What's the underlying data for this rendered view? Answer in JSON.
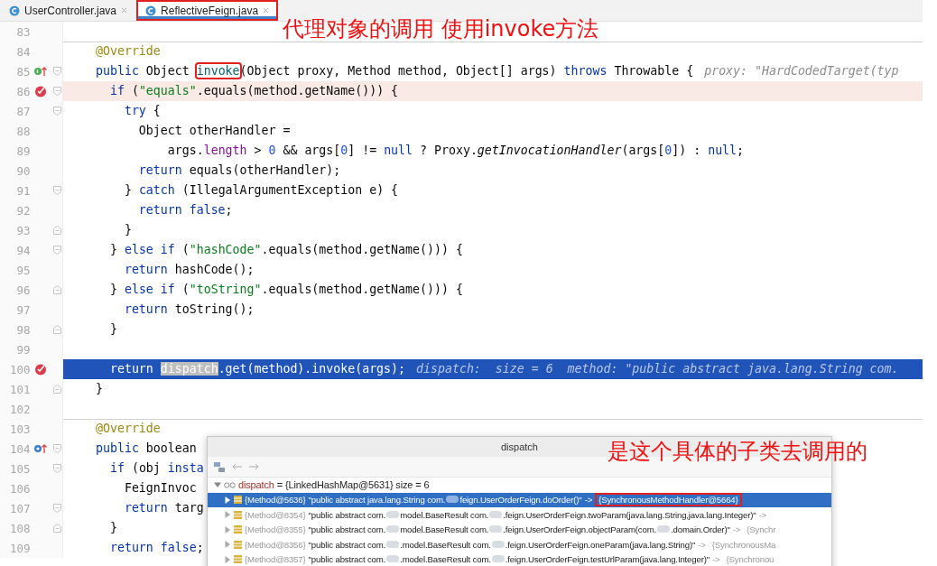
{
  "tabs": [
    {
      "label": "UserController.java",
      "selected": false,
      "boxed": false
    },
    {
      "label": "ReflectiveFeign.java",
      "selected": true,
      "boxed": true
    }
  ],
  "editor": {
    "lines": [
      {
        "number": "83"
      },
      {
        "number": "84",
        "separator": true,
        "tokens": [
          {
            "t": "@Override",
            "kind": "annotation"
          }
        ]
      },
      {
        "number": "85",
        "implements": true,
        "fold_start": true,
        "tokens": [
          {
            "t": "public",
            "kind": "keyword"
          },
          {
            "t": " Object ",
            "kind": "plain"
          },
          {
            "t": "invoke",
            "kind": "declaration",
            "boxed": true
          },
          {
            "t": "(Object proxy, Method method, Object[] args) ",
            "kind": "plain"
          },
          {
            "t": "throws",
            "kind": "keyword"
          },
          {
            "t": " Throwable {",
            "kind": "plain"
          },
          {
            "t": "proxy: \"HardCodedTarget(typ",
            "kind": "hint"
          }
        ]
      },
      {
        "number": "86",
        "breakpoint": true,
        "fold_start": true,
        "tokens": [
          {
            "t": "  if",
            "kind": "keyword"
          },
          {
            "t": " (",
            "kind": "plain"
          },
          {
            "t": "\"equals\"",
            "kind": "string"
          },
          {
            "t": ".equals(method.getName())) {",
            "kind": "plain"
          }
        ]
      },
      {
        "number": "87",
        "fold_start": true,
        "tokens": [
          {
            "t": "    try",
            "kind": "keyword"
          },
          {
            "t": " {",
            "kind": "plain"
          }
        ]
      },
      {
        "number": "88",
        "tokens": [
          {
            "t": "      Object otherHandler =",
            "kind": "plain"
          }
        ]
      },
      {
        "number": "89",
        "tokens": [
          {
            "t": "          args.",
            "kind": "plain"
          },
          {
            "t": "length",
            "kind": "field"
          },
          {
            "t": " > ",
            "kind": "plain"
          },
          {
            "t": "0",
            "kind": "number"
          },
          {
            "t": " && args[",
            "kind": "plain"
          },
          {
            "t": "0",
            "kind": "number"
          },
          {
            "t": "] != ",
            "kind": "plain"
          },
          {
            "t": "null",
            "kind": "keyword"
          },
          {
            "t": " ? Proxy.",
            "kind": "plain"
          },
          {
            "t": "getInvocationHandler",
            "kind": "static"
          },
          {
            "t": "(args[",
            "kind": "plain"
          },
          {
            "t": "0",
            "kind": "number"
          },
          {
            "t": "]) : ",
            "kind": "plain"
          },
          {
            "t": "null",
            "kind": "keyword"
          },
          {
            "t": ";",
            "kind": "plain"
          }
        ]
      },
      {
        "number": "90",
        "tokens": [
          {
            "t": "      return",
            "kind": "keyword"
          },
          {
            "t": " equals(otherHandler);",
            "kind": "plain"
          }
        ]
      },
      {
        "number": "91",
        "fold_start": true,
        "tokens": [
          {
            "t": "    } ",
            "kind": "plain"
          },
          {
            "t": "catch",
            "kind": "keyword"
          },
          {
            "t": " (IllegalArgumentException e) {",
            "kind": "plain"
          }
        ]
      },
      {
        "number": "92",
        "tokens": [
          {
            "t": "      return false",
            "kind": "keyword"
          },
          {
            "t": ";",
            "kind": "plain"
          }
        ]
      },
      {
        "number": "93",
        "fold_end": true,
        "tokens": [
          {
            "t": "    }",
            "kind": "plain"
          }
        ]
      },
      {
        "number": "94",
        "fold_start": true,
        "tokens": [
          {
            "t": "  } ",
            "kind": "plain"
          },
          {
            "t": "else if",
            "kind": "keyword"
          },
          {
            "t": " (",
            "kind": "plain"
          },
          {
            "t": "\"hashCode\"",
            "kind": "string"
          },
          {
            "t": ".equals(method.getName())) {",
            "kind": "plain"
          }
        ]
      },
      {
        "number": "95",
        "tokens": [
          {
            "t": "    return",
            "kind": "keyword"
          },
          {
            "t": " hashCode();",
            "kind": "plain"
          }
        ]
      },
      {
        "number": "96",
        "fold_end": true,
        "tokens": [
          {
            "t": "  } ",
            "kind": "plain"
          },
          {
            "t": "else if",
            "kind": "keyword"
          },
          {
            "t": " (",
            "kind": "plain"
          },
          {
            "t": "\"toString\"",
            "kind": "string"
          },
          {
            "t": ".equals(method.getName())) {",
            "kind": "plain"
          }
        ]
      },
      {
        "number": "97",
        "tokens": [
          {
            "t": "    return",
            "kind": "keyword"
          },
          {
            "t": " toString();",
            "kind": "plain"
          }
        ]
      },
      {
        "number": "98",
        "fold_end": true,
        "tokens": [
          {
            "t": "  }",
            "kind": "plain"
          }
        ]
      },
      {
        "number": "99"
      },
      {
        "number": "100",
        "breakpoint": true,
        "current": true,
        "tokens": [
          {
            "t": "  return ",
            "kind": "keyword"
          },
          {
            "t": "dispatch",
            "kind": "selected"
          },
          {
            "t": ".get(method).invoke(args);",
            "kind": "plain"
          },
          {
            "t": "dispatch:  size = 6  method: \"public abstract java.lang.String com.",
            "kind": "hint"
          }
        ]
      },
      {
        "number": "101",
        "fold_end": true,
        "tokens": [
          {
            "t": "}",
            "kind": "plain"
          }
        ]
      },
      {
        "number": "102"
      },
      {
        "number": "103",
        "separator": true,
        "tokens": [
          {
            "t": "@Override",
            "kind": "annotation"
          }
        ]
      },
      {
        "number": "104",
        "overrides": true,
        "fold_start": true,
        "tokens": [
          {
            "t": "public",
            "kind": "keyword"
          },
          {
            "t": " boolean",
            "kind": "plain"
          }
        ]
      },
      {
        "number": "105",
        "fold_start": true,
        "tokens": [
          {
            "t": "  if",
            "kind": "keyword"
          },
          {
            "t": " (obj ",
            "kind": "plain"
          },
          {
            "t": "insta",
            "kind": "keyword"
          }
        ]
      },
      {
        "number": "106",
        "tokens": [
          {
            "t": "    FeignInvoc",
            "kind": "plain"
          }
        ]
      },
      {
        "number": "107",
        "fold_start": true,
        "tokens": [
          {
            "t": "    return",
            "kind": "keyword"
          },
          {
            "t": " targ",
            "kind": "plain"
          }
        ]
      },
      {
        "number": "108",
        "fold_end": true,
        "tokens": [
          {
            "t": "  }",
            "kind": "plain"
          }
        ]
      },
      {
        "number": "109",
        "tokens": [
          {
            "t": "  return false",
            "kind": "keyword"
          },
          {
            "t": ";",
            "kind": "plain"
          }
        ]
      }
    ]
  },
  "popup": {
    "title": "dispatch",
    "root": {
      "expanded": true,
      "name": "dispatch",
      "value": " = {LinkedHashMap@5631}  size = 6"
    },
    "entries": [
      {
        "selected": true,
        "key": "{Method@5636}",
        "segments": [
          "\"public abstract java.lang.String com.",
          "feign.UserOrderFeign.doOrder()\""
        ],
        "arrow": "->",
        "target": "{SynchronousMethodHandler@5664}",
        "boxed": true
      },
      {
        "selected": false,
        "key": "{Method@8354}",
        "segments": [
          "\"public abstract com.",
          "model.BaseResult com.",
          ".feign.UserOrderFeign.twoParam(java.lang.String,java.lang.Integer)\""
        ],
        "arrow": "->"
      },
      {
        "selected": false,
        "key": "{Method@8355}",
        "segments": [
          "\"public abstract com.",
          "model.BaseResult com.",
          ".feign.UserOrderFeign.objectParam(com.",
          ".domain.Order)\""
        ],
        "arrow": "->",
        "target": "{Synchr",
        "boxed": false
      },
      {
        "selected": false,
        "key": "{Method@8356}",
        "segments": [
          "\"public abstract com.",
          ".model.BaseResult com.",
          ".feign.UserOrderFeign.oneParam(java.lang.String)\""
        ],
        "arrow": "->",
        "target": "{SynchronousMa",
        "boxed": false
      },
      {
        "selected": false,
        "key": "{Method@8357}",
        "segments": [
          "\"public abstract com.",
          ".model.BaseResult com.",
          ".feign.UserOrderFeign.testUrlParam(java.lang.Integer)\""
        ],
        "arrow": "->",
        "target": "{Synchronou",
        "boxed": false
      }
    ]
  },
  "notes": [
    "代理对象的调用 使用invoke方法",
    "是这个具体的子类去调用的"
  ]
}
